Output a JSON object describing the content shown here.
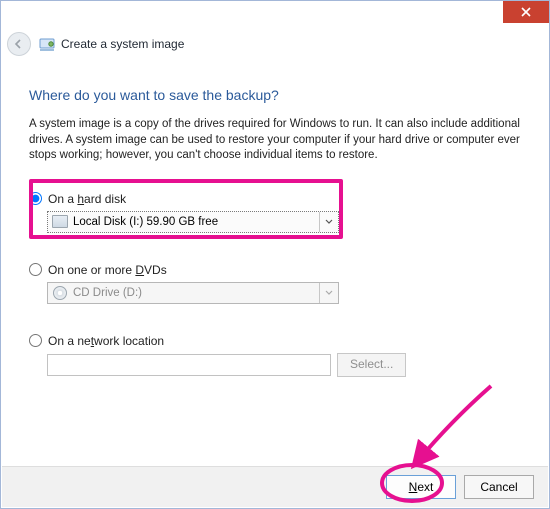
{
  "window": {
    "title": "Create a system image"
  },
  "main": {
    "heading": "Where do you want to save the backup?",
    "description": "A system image is a copy of the drives required for Windows to run. It can also include additional drives. A system image can be used to restore your computer if your hard drive or computer ever stops working; however, you can't choose individual items to restore."
  },
  "options": {
    "hard_disk": {
      "label_pre": "On a ",
      "label_u": "h",
      "label_post": "ard disk",
      "value": "Local Disk (I:)  59.90 GB free",
      "selected": true
    },
    "dvd": {
      "label_pre": "On one or more ",
      "label_u": "D",
      "label_post": "VDs",
      "value": "CD Drive (D:)",
      "selected": false
    },
    "network": {
      "label_pre": "On a ne",
      "label_u": "t",
      "label_post": "work location",
      "button": "Select...",
      "selected": false
    }
  },
  "footer": {
    "next_u": "N",
    "next_post": "ext",
    "cancel": "Cancel"
  },
  "annotation": {
    "arrow_color": "#e61090",
    "circle_color": "#e61090"
  }
}
